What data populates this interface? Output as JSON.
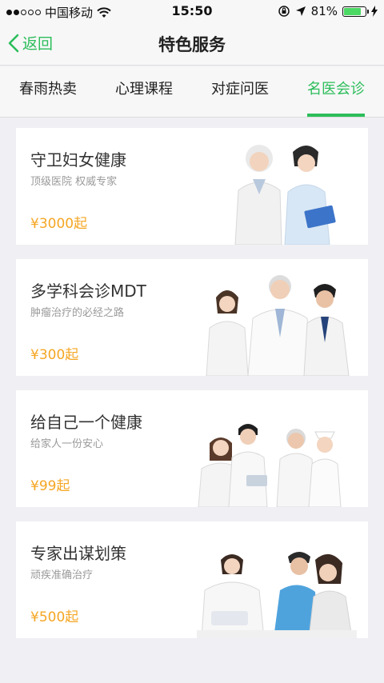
{
  "status": {
    "carrier": "中国移动",
    "time": "15:50",
    "battery": "81%"
  },
  "nav": {
    "back_label": "返回",
    "title": "特色服务"
  },
  "tabs": [
    {
      "label": "春雨热卖",
      "active": false
    },
    {
      "label": "心理课程",
      "active": false
    },
    {
      "label": "对症问医",
      "active": false
    },
    {
      "label": "名医会诊",
      "active": true
    }
  ],
  "cards": [
    {
      "title": "守卫妇女健康",
      "subtitle": "顶级医院 权威专家",
      "price": "¥3000起",
      "image": "doctor-and-patient-illustration"
    },
    {
      "title": "多学科会诊MDT",
      "subtitle": "肿瘤治疗的必经之路",
      "price": "¥300起",
      "image": "doctor-team-illustration"
    },
    {
      "title": "给自己一个健康",
      "subtitle": "给家人一份安心",
      "price": "¥99起",
      "image": "medical-staff-illustration"
    },
    {
      "title": "专家出谋划策",
      "subtitle": "顽疾准确治疗",
      "price": "¥500起",
      "image": "consultation-illustration"
    }
  ],
  "colors": {
    "accent": "#2bbd5a",
    "price": "#f5a623"
  }
}
